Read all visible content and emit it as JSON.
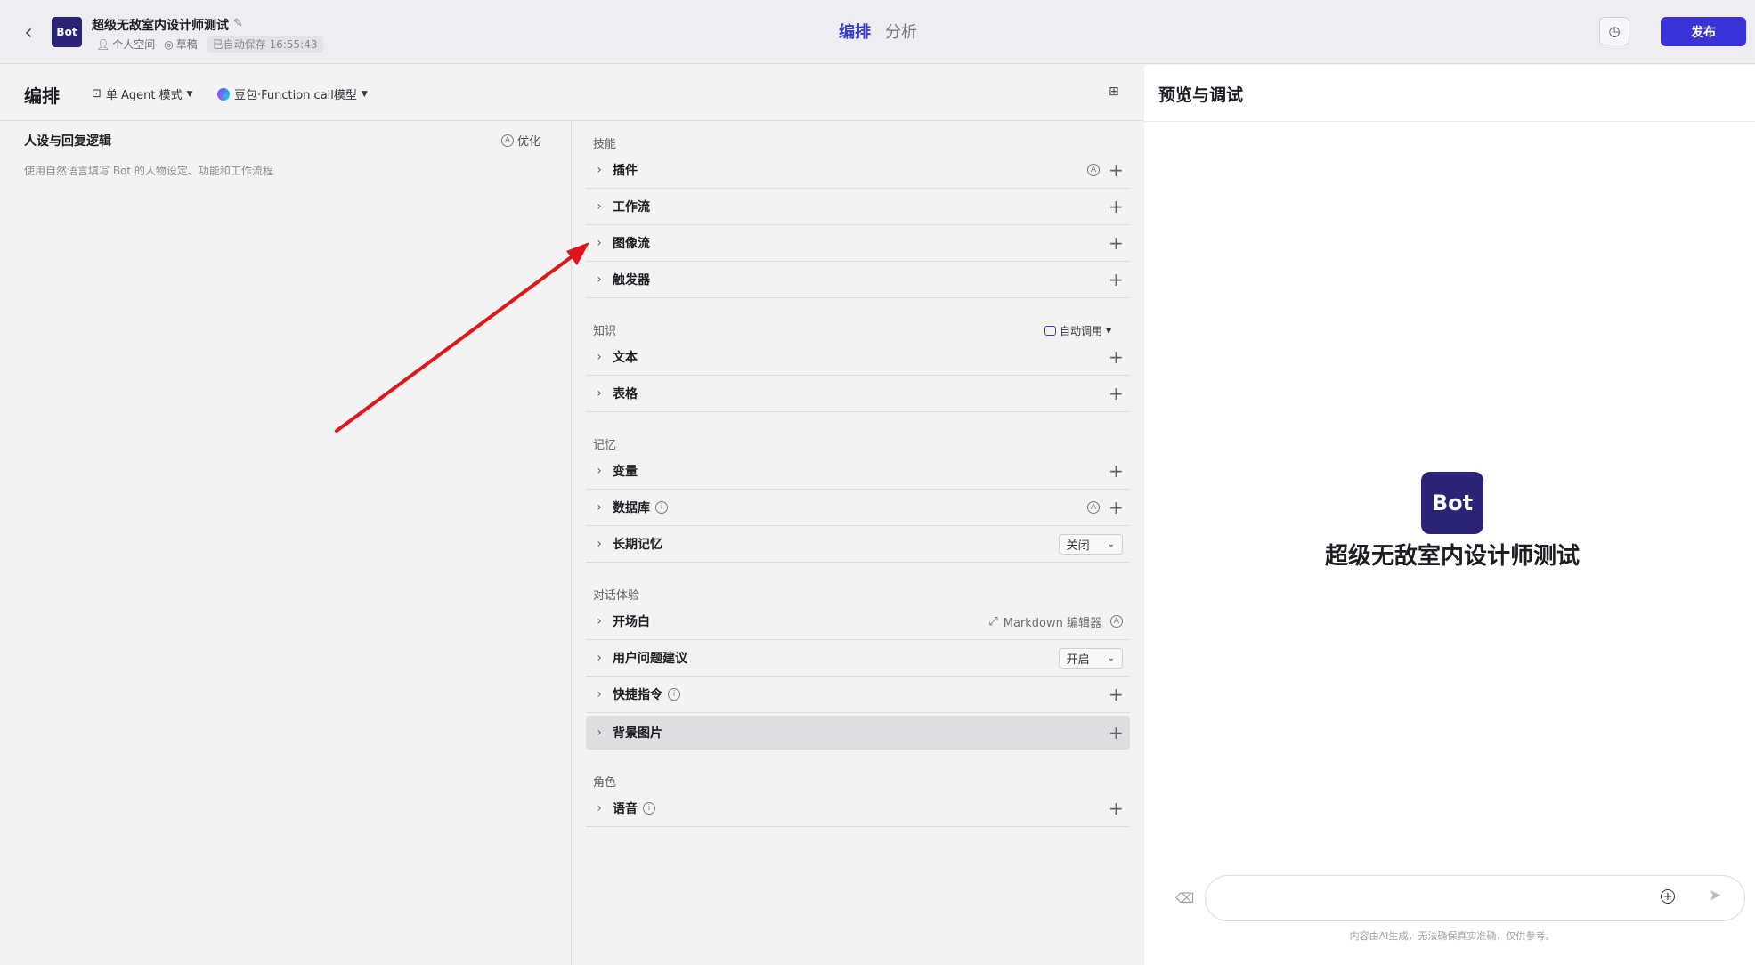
{
  "topbar": {
    "bot_avatar_text": "Bot",
    "bot_name": "超级无敌室内设计师测试",
    "space": "个人空间",
    "status": "草稿",
    "autosave": "已自动保存 16:55:43",
    "tabs": [
      "编排",
      "分析"
    ],
    "active_tab": "编排",
    "publish_label": "发布"
  },
  "editor": {
    "title": "编排",
    "mode": "单 Agent 模式",
    "model": "豆包·Function call模型"
  },
  "persona": {
    "title": "人设与回复逻辑",
    "optimize_label": "优化",
    "placeholder": "使用自然语言填写 Bot 的人物设定、功能和工作流程"
  },
  "sections": {
    "skills": {
      "title": "技能",
      "items": [
        "插件",
        "工作流",
        "图像流",
        "触发器"
      ]
    },
    "knowledge": {
      "title": "知识",
      "auto_call": "自动调用",
      "items": [
        "文本",
        "表格"
      ]
    },
    "memory": {
      "title": "记忆",
      "items": [
        "变量",
        "数据库",
        "长期记忆"
      ],
      "long_term_value": "关闭"
    },
    "dialog": {
      "title": "对话体验",
      "items": [
        "开场白",
        "用户问题建议",
        "快捷指令",
        "背景图片"
      ],
      "markdown_label": "Markdown 编辑器",
      "suggestion_value": "开启"
    },
    "role": {
      "title": "角色",
      "items": [
        "语音"
      ]
    }
  },
  "preview": {
    "title": "预览与调试",
    "avatar_text": "Bot",
    "bot_name": "超级无敌室内设计师测试",
    "input_placeholder": "",
    "disclaimer": "内容由AI生成，无法确保真实准确，仅供参考。"
  },
  "colors": {
    "accent": "#3a33d9",
    "avatar_bg": "#2b2476",
    "arrow": "#e0161a"
  }
}
